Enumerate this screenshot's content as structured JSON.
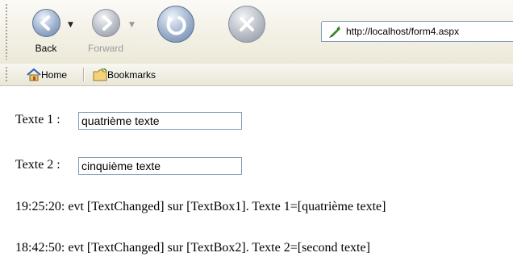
{
  "toolbar": {
    "back": {
      "label": "Back"
    },
    "forward": {
      "label": "Forward"
    },
    "address": {
      "url": "http://localhost/form4.aspx"
    }
  },
  "links": [
    {
      "label": "Home"
    },
    {
      "label": "Bookmarks"
    }
  ],
  "form": {
    "field1": {
      "label": "Texte 1 :",
      "value": "quatrième texte"
    },
    "field2": {
      "label": "Texte 2 :",
      "value": "cinquième texte"
    }
  },
  "log": [
    "19:25:20: evt [TextChanged] sur [TextBox1]. Texte 1=[quatrième texte]",
    "18:42:50: evt [TextChanged] sur [TextBox2]. Texte 2=[second texte]"
  ],
  "icons": {
    "back": "arrow-left-icon",
    "forward": "arrow-right-icon",
    "reload": "reload-icon",
    "stop": "stop-icon",
    "home": "home-icon",
    "bookmarks": "bookmarks-folder-icon",
    "page": "page-icon"
  },
  "colors": {
    "accent": "#6c84a8",
    "border": "#7f9db9",
    "toolbar": "#ece9d8"
  }
}
